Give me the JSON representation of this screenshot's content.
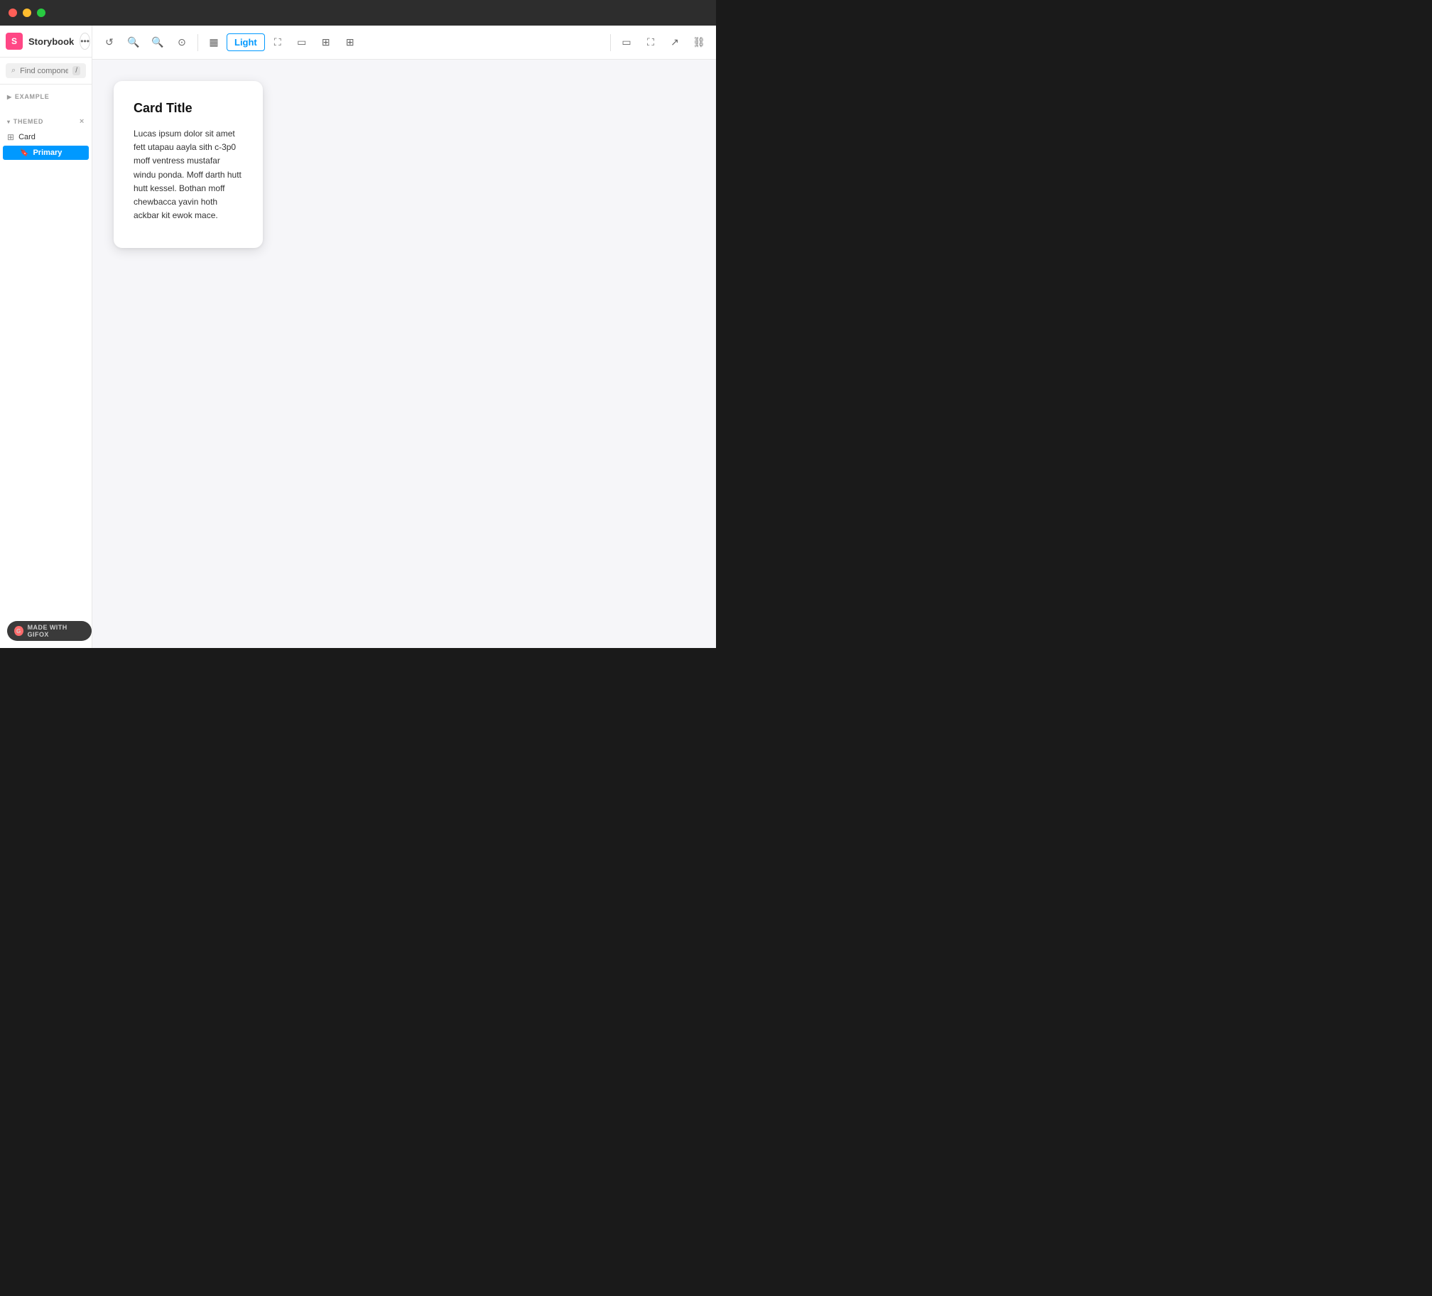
{
  "titlebar": {
    "traffic_lights": [
      "red",
      "yellow",
      "green"
    ]
  },
  "header": {
    "logo_letter": "S",
    "app_title": "Storybook",
    "more_btn_label": "•••",
    "toolbar": {
      "reset_icon": "↺",
      "zoom_in_icon": "+",
      "zoom_out_icon": "−",
      "zoom_reset_icon": "⊙",
      "divider1": true,
      "background_icon": "▦",
      "active_mode": "Light",
      "fullscreen_icon": "⛶",
      "viewport_icon": "▭",
      "image_icon": "⊞",
      "grid_icon": "⊞",
      "divider2": true,
      "panel_icon": "▭",
      "expand_icon": "⛶",
      "new_tab_icon": "↗",
      "link_icon": "🔗"
    }
  },
  "sidebar": {
    "search_placeholder": "Find components",
    "keyboard_shortcut": "/",
    "sections": [
      {
        "id": "example",
        "label": "EXAMPLE",
        "collapsed": true,
        "arrow": "▶"
      },
      {
        "id": "themed",
        "label": "THEMED",
        "collapsed": false,
        "arrow": "▾",
        "close_icon": "×",
        "items": [
          {
            "id": "card",
            "label": "Card",
            "icon": "⊞",
            "type": "component",
            "children": [
              {
                "id": "primary",
                "label": "Primary",
                "icon": "🔖",
                "active": true
              }
            ]
          }
        ]
      }
    ]
  },
  "preview": {
    "card": {
      "title": "Card Title",
      "body": "Lucas ipsum dolor sit amet fett utapau aayla sith c-3p0 moff ventress mustafar windu ponda. Moff darth hutt hutt kessel. Bothan moff chewbacca yavin hoth ackbar kit ewok mace."
    }
  },
  "gifox_badge": {
    "icon": "G",
    "label": "MADE WITH GIFOX"
  }
}
